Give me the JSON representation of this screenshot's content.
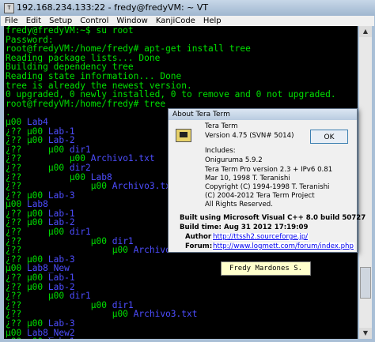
{
  "window": {
    "title": "192.168.234.133:22 - fredy@fredyVM: ~ VT",
    "icon": "tera-term-app-icon"
  },
  "menu": [
    "File",
    "Edit",
    "Setup",
    "Control",
    "Window",
    "KanjiCode",
    "Help"
  ],
  "terminal": {
    "lines": [
      {
        "t": "fredy@fredyVM:~$ su root"
      },
      {
        "t": "Password:"
      },
      {
        "t": "root@fredyVM:/home/fredy# apt-get install tree"
      },
      {
        "t": "Reading package lists... Done"
      },
      {
        "t": "Building dependency tree"
      },
      {
        "t": "Reading state information... Done"
      },
      {
        "t": "tree is already the newest version."
      },
      {
        "t": "0 upgraded, 0 newly installed, 0 to remove and 0 not upgraded."
      },
      {
        "t": "root@fredyVM:/home/fredy# tree"
      },
      {
        "t": "."
      },
      {
        "t": "µ00 ",
        "d": "Lab4"
      },
      {
        "t": "¿?? µ00 ",
        "d": "Lab-1"
      },
      {
        "t": "¿?? µ00 ",
        "d": "Lab-2"
      },
      {
        "t": "¿??     µ00 ",
        "d": "dir1"
      },
      {
        "t": "¿??         µ00 ",
        "d": "Archivo1.txt"
      },
      {
        "t": "¿??     µ00 ",
        "d": "dir2"
      },
      {
        "t": "¿??         µ00 ",
        "d": "Lab8"
      },
      {
        "t": "¿??             µ00 ",
        "d": "Archivo3.txt"
      },
      {
        "t": "¿?? µ00 ",
        "d": "Lab-3"
      },
      {
        "t": "µ00 ",
        "d": "Lab8"
      },
      {
        "t": "¿?? µ00 ",
        "d": "Lab-1"
      },
      {
        "t": "¿?? µ00 ",
        "d": "Lab-2"
      },
      {
        "t": "¿??     µ00 ",
        "d": "dir1"
      },
      {
        "t": "¿??             µ00 ",
        "d": "dir1"
      },
      {
        "t": "¿??                 µ00 ",
        "d": "Archivo3.txt"
      },
      {
        "t": "¿?? µ00 ",
        "d": "Lab-3"
      },
      {
        "t": "µ00 ",
        "d": "Lab8_New"
      },
      {
        "t": "¿?? µ00 ",
        "d": "Lab-1"
      },
      {
        "t": "¿?? µ00 ",
        "d": "Lab-2"
      },
      {
        "t": "¿??     µ00 ",
        "d": "dir1"
      },
      {
        "t": "¿??             µ00 ",
        "d": "dir1"
      },
      {
        "t": "¿??                 µ00 ",
        "d": "Archivo3.txt"
      },
      {
        "t": "¿?? µ00 ",
        "d": "Lab-3"
      },
      {
        "t": "µ00 ",
        "d": "Lab8_New2"
      },
      {
        "t": "¿?? µ00 ",
        "d": "Lab-1"
      },
      {
        "t": "¿?? µ00 ",
        "d": "Lab-2"
      }
    ]
  },
  "about_dialog": {
    "title": "About Tera Term",
    "ok_label": "OK",
    "app_name": "Tera Term",
    "version": "Version 4.75 (SVN# 5014)",
    "includes_label": "Includes:",
    "includes": [
      "Oniguruma 5.9.2",
      "Tera Term Pro version 2.3 + IPv6 0.81",
      "Mar 10, 1998 T. Teranishi",
      "Copyright (C) 1994-1998 T. Teranishi",
      "(C) 2004-2012 Tera Term Project",
      "All Rights Reserved."
    ],
    "built_using": "Built using Microsoft Visual C++ 8.0 build 50727",
    "build_time": "Build time: Aug 31 2012 17:19:09",
    "author_label": "Author:",
    "author_url": "http://ttssh2.sourceforge.jp/",
    "forum_label": "Forum:",
    "forum_url": "http://www.logmett.com/forum/index.php"
  },
  "name_tag": "Fredy Mardones S.",
  "colors": {
    "terminal_bg": "#000000",
    "terminal_text": "#00e000",
    "directory_text": "#4d4dff"
  }
}
